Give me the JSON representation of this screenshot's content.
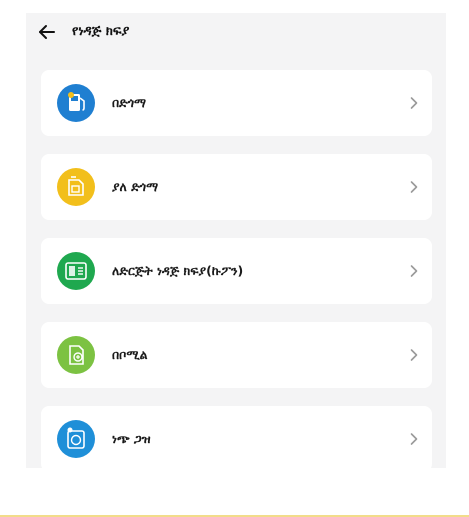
{
  "header": {
    "title": "የነዳጅ ክፍያ"
  },
  "options": [
    {
      "label": "በድጎማ",
      "color": "#1f7fd1",
      "icon": "fuel-pump-icon"
    },
    {
      "label": "ያለ ድጎማ",
      "color": "#f2bf1b",
      "icon": "fuel-can-icon"
    },
    {
      "label": "ለድርጅት ነዳጅ ክፍያ(ኩፖን)",
      "color": "#1fa84f",
      "icon": "coupon-icon"
    },
    {
      "label": "በቦሚል",
      "color": "#7cc242",
      "icon": "document-icon"
    },
    {
      "label": "ነጭ ጋዝ",
      "color": "#1f8fd8",
      "icon": "gas-tank-icon"
    }
  ]
}
